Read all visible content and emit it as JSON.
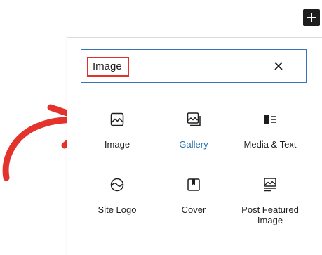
{
  "toolbar": {
    "add_icon": "plus-icon"
  },
  "search": {
    "value": "Image",
    "clear_icon": "close-icon"
  },
  "blocks": [
    {
      "label": "Image",
      "icon": "image-icon",
      "active": false
    },
    {
      "label": "Gallery",
      "icon": "gallery-icon",
      "active": true
    },
    {
      "label": "Media & Text",
      "icon": "media-text-icon",
      "active": false
    },
    {
      "label": "Site Logo",
      "icon": "site-logo-icon",
      "active": false
    },
    {
      "label": "Cover",
      "icon": "cover-icon",
      "active": false
    },
    {
      "label": "Post Featured Image",
      "icon": "post-featured-image-icon",
      "active": false
    }
  ],
  "colors": {
    "accent": "#2271b1",
    "highlight": "#e0322b",
    "arrow": "#e4322c",
    "focus_border": "#3873b6",
    "text": "#1e1e1e"
  }
}
